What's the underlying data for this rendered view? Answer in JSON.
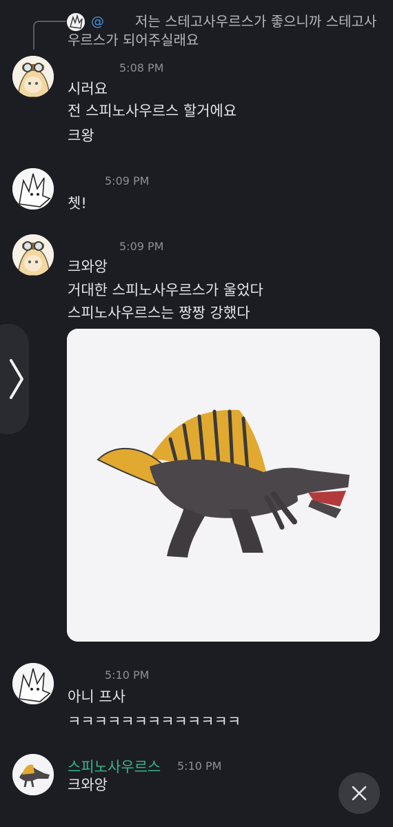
{
  "reply": {
    "at": "@",
    "text": "저는 스테고사우르스가 좋으니까 스테고사우르스가 되어주실래요"
  },
  "messages": [
    {
      "time": "5:08 PM",
      "lines": [
        "시러요",
        "전 스피노사우르스 할거에요",
        "크왕"
      ]
    },
    {
      "time": "5:09 PM",
      "lines": [
        "쳇!"
      ]
    },
    {
      "time": "5:09 PM",
      "lines": [
        "크와앙",
        "거대한 스피노사우르스가 울었다",
        "스피노사우르스는 짱짱 강했다"
      ]
    },
    {
      "time": "5:10 PM",
      "lines": [
        "아니 프사",
        "ㅋㅋㅋㅋㅋㅋㅋㅋㅋㅋㅋㅋㅋ"
      ]
    },
    {
      "username": "스피노사우르스",
      "time": "5:10 PM",
      "lines": [
        "크와앙"
      ]
    }
  ],
  "colors": {
    "background": "#1c1d22",
    "username_green": "#35b88a",
    "mention_blue": "#4a90d9"
  },
  "icons": {
    "side_tab": "chevron-right-icon",
    "close": "close-icon"
  }
}
